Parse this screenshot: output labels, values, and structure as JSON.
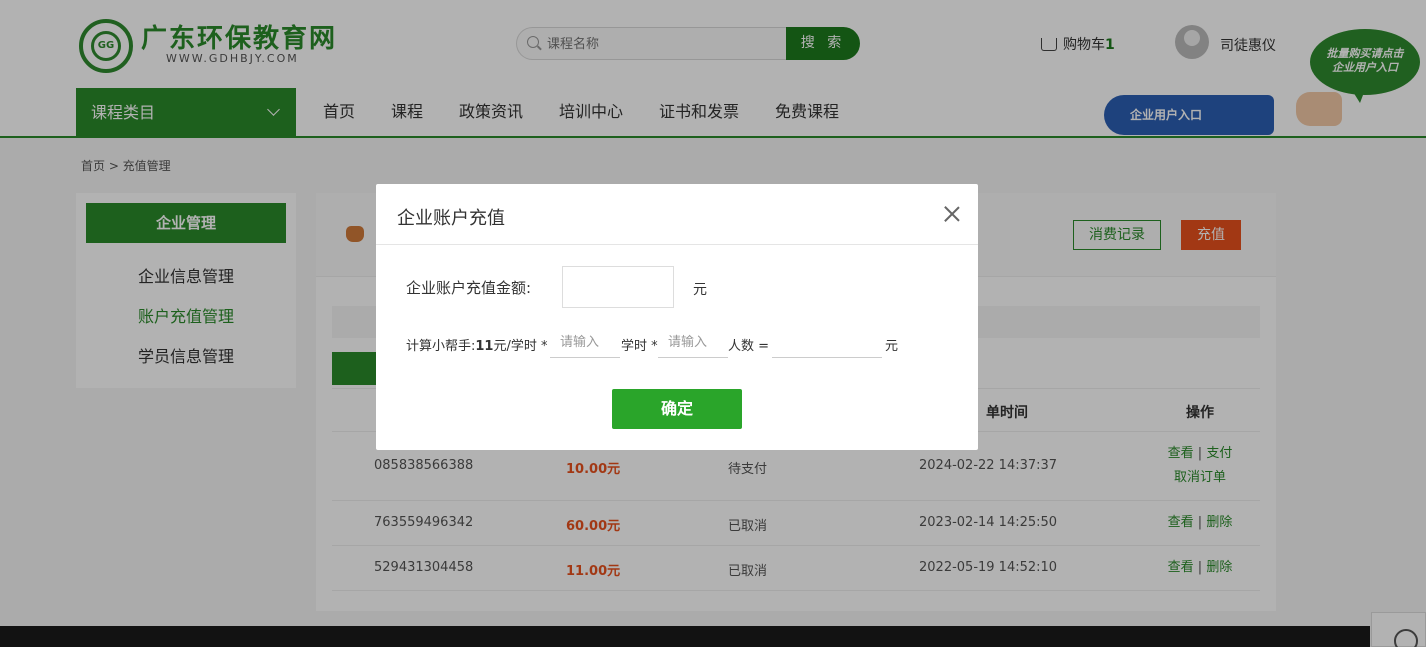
{
  "header": {
    "logo_badge": "GG",
    "site_title": "广东环保教育网",
    "site_url": "WWW.GDHBJY.COM",
    "search_placeholder": "课程名称",
    "search_button": "搜 索",
    "cart_label": "购物车",
    "cart_count": "1",
    "username": "司徒惠仪",
    "bulk_bubble_line1": "批量购买请点击",
    "bulk_bubble_line2": "企业用户入口",
    "enterprise_entry": "企业用户入口"
  },
  "nav": {
    "category_menu": "课程类目",
    "items": [
      "首页",
      "课程",
      "政策资讯",
      "培训中心",
      "证书和发票",
      "免费课程"
    ]
  },
  "breadcrumb": "首页 > 充值管理",
  "sidebar": {
    "title": "企业管理",
    "items": [
      {
        "label": "企业信息管理"
      },
      {
        "label": "账户充值管理"
      },
      {
        "label": "学员信息管理"
      }
    ]
  },
  "main": {
    "records_button": "消费记录",
    "recharge_button": "充值",
    "table_headers": {
      "time_partial": "单时间",
      "ops": "操作"
    },
    "rows": [
      {
        "order_no": "085838566388",
        "amount": "10.00元",
        "status": "待支付",
        "time": "2024-02-22 14:37:37",
        "ops": [
          "查看",
          "支付",
          "取消订单"
        ]
      },
      {
        "order_no": "763559496342",
        "amount": "60.00元",
        "status": "已取消",
        "time": "2023-02-14 14:25:50",
        "ops": [
          "查看",
          "删除"
        ]
      },
      {
        "order_no": "529431304458",
        "amount": "11.00元",
        "status": "已取消",
        "time": "2022-05-19 14:52:10",
        "ops": [
          "查看",
          "删除"
        ]
      }
    ]
  },
  "modal": {
    "title": "企业账户充值",
    "amount_label": "企业账户充值金额:",
    "amount_value": "",
    "amount_unit": "元",
    "calc_prefix": "计算小帮手:",
    "calc_rate": "11",
    "calc_rate_unit": "元/学时 *",
    "hours_placeholder": "请输入",
    "hours_suffix": "学时 *",
    "people_placeholder": "请输入",
    "people_suffix": "人数 =",
    "result_value": "",
    "result_unit": "元",
    "confirm_button": "确定"
  },
  "colors": {
    "brand_green": "#2a8a2a",
    "accent_orange": "#e8511e",
    "confirm_green": "#2aa52a"
  }
}
